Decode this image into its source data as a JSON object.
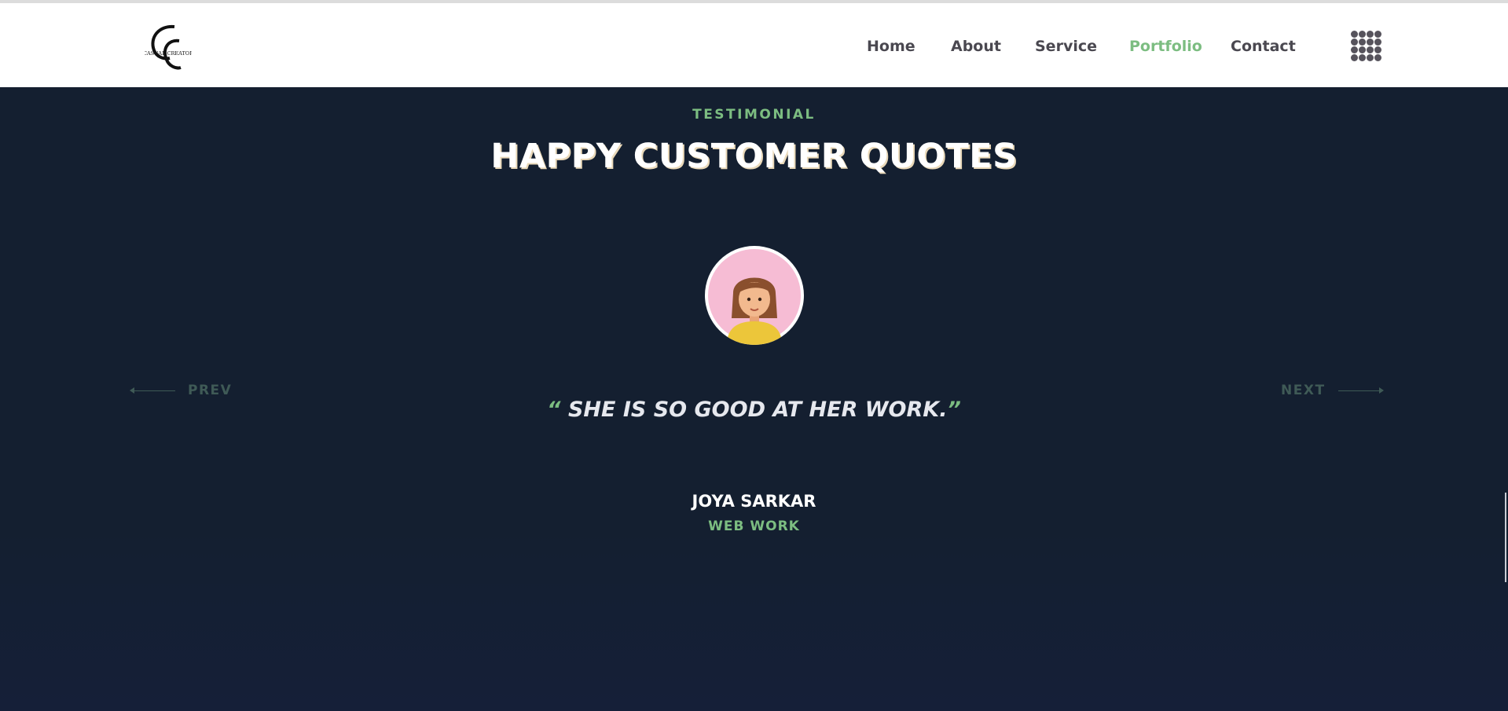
{
  "header": {
    "logo_text": "CASUAL CREATOR",
    "nav": [
      {
        "label": "Home",
        "active": false
      },
      {
        "label": "About",
        "active": false
      },
      {
        "label": "Service",
        "active": false
      },
      {
        "label": "Portfolio",
        "active": true
      },
      {
        "label": "Contact",
        "active": false
      }
    ],
    "menu_icon": "grid-dots-icon"
  },
  "testimonial": {
    "eyebrow": "TESTIMONIAL",
    "title": "HAPPY CUSTOMER QUOTES",
    "prev_label": "PREV",
    "next_label": "NEXT",
    "quote_open": "“",
    "quote_text": "SHE IS SO GOOD AT HER WORK.",
    "quote_close": "”",
    "author_name": "JOYA SARKAR",
    "author_role": "WEB WORK"
  },
  "colors": {
    "accent": "#7cbd81",
    "background": "#141f30",
    "nav_text": "#4a4850"
  }
}
